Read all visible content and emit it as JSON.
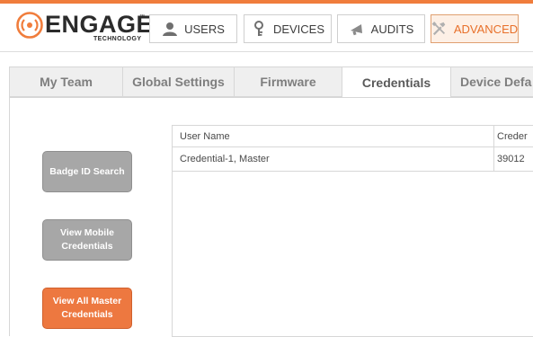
{
  "brand": {
    "name": "ENGAGE",
    "tm": "™",
    "subtitle": "TECHNOLOGY",
    "accent": "#f07d3c"
  },
  "nav": {
    "items": [
      {
        "label": "USERS",
        "icon": "user-icon"
      },
      {
        "label": "DEVICES",
        "icon": "key-icon"
      },
      {
        "label": "AUDITS",
        "icon": "megaphone-icon"
      },
      {
        "label": "ADVANCED",
        "icon": "tools-icon",
        "active": true
      }
    ]
  },
  "tabs": {
    "items": [
      {
        "label": "My Team"
      },
      {
        "label": "Global Settings"
      },
      {
        "label": "Firmware"
      },
      {
        "label": "Credentials",
        "active": true
      },
      {
        "label": "Device Defa"
      }
    ]
  },
  "sidebar": {
    "badge_search": "Badge ID Search",
    "view_mobile": "View Mobile Credentials",
    "view_master": "View All Master Credentials"
  },
  "table": {
    "headers": [
      "User Name",
      "Creder"
    ],
    "rows": [
      [
        "Credential-1, Master",
        "39012"
      ]
    ]
  }
}
